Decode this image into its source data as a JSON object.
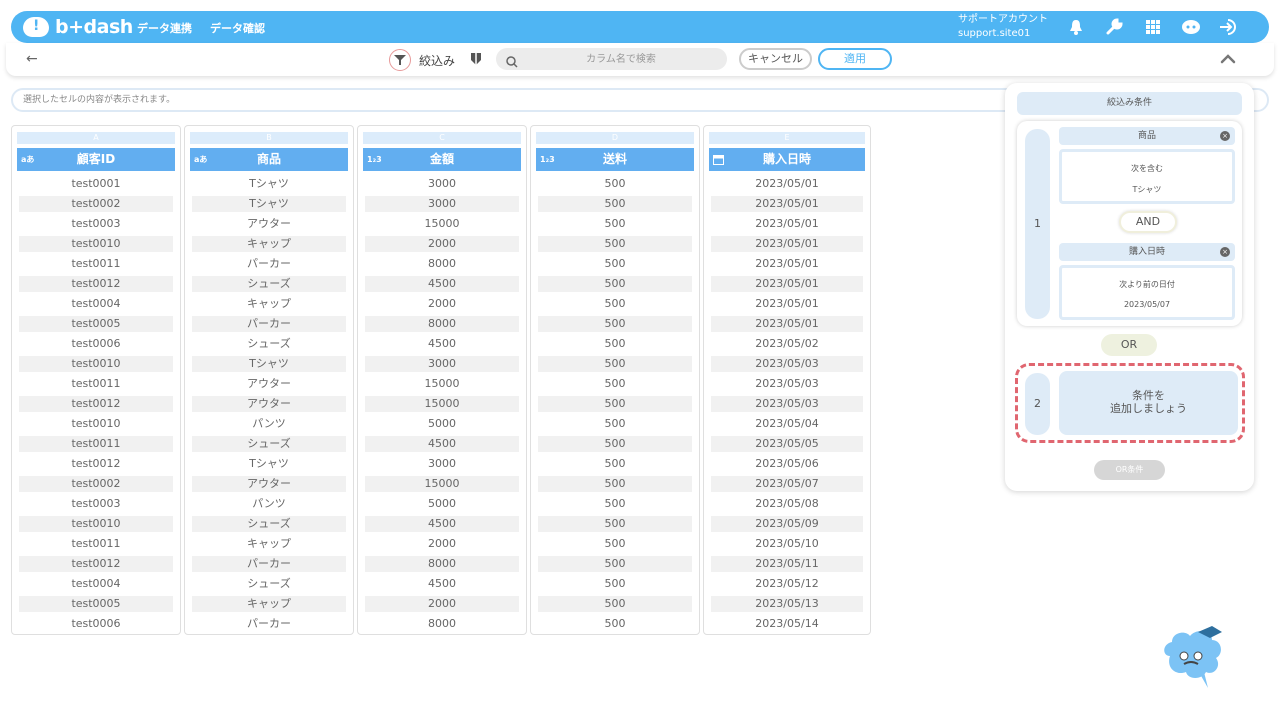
{
  "header": {
    "brand": "b+dash",
    "nav": [
      "データ連携",
      "データ確認"
    ],
    "account_name": "サポートアカウント",
    "account_id": "support.site01",
    "icons": [
      "bell-icon",
      "wrench-icon",
      "grid-icon",
      "mascot-badge-icon",
      "logout-icon"
    ]
  },
  "toolbar": {
    "back_label": "←",
    "filter_label": "絞込み",
    "search_placeholder": "カラム名で検索",
    "cancel_label": "キャンセル",
    "apply_label": "適用"
  },
  "cellbar": {
    "placeholder": "選択したセルの内容が表示されます。"
  },
  "columns": [
    {
      "letter": "A",
      "type_label": "aあ",
      "name": "顧客ID",
      "values": [
        "test0001",
        "test0002",
        "test0003",
        "test0010",
        "test0011",
        "test0012",
        "test0004",
        "test0005",
        "test0006",
        "test0010",
        "test0011",
        "test0012",
        "test0010",
        "test0011",
        "test0012",
        "test0002",
        "test0003",
        "test0010",
        "test0011",
        "test0012",
        "test0004",
        "test0005",
        "test0006"
      ]
    },
    {
      "letter": "B",
      "type_label": "aあ",
      "name": "商品",
      "values": [
        "Tシャツ",
        "Tシャツ",
        "アウター",
        "キャップ",
        "パーカー",
        "シューズ",
        "キャップ",
        "パーカー",
        "シューズ",
        "Tシャツ",
        "アウター",
        "アウター",
        "パンツ",
        "シューズ",
        "Tシャツ",
        "アウター",
        "パンツ",
        "シューズ",
        "キャップ",
        "パーカー",
        "シューズ",
        "キャップ",
        "パーカー"
      ]
    },
    {
      "letter": "C",
      "type_label": "1₂3",
      "name": "金額",
      "values": [
        "3000",
        "3000",
        "15000",
        "2000",
        "8000",
        "4500",
        "2000",
        "8000",
        "4500",
        "3000",
        "15000",
        "15000",
        "5000",
        "4500",
        "3000",
        "15000",
        "5000",
        "4500",
        "2000",
        "8000",
        "4500",
        "2000",
        "8000"
      ]
    },
    {
      "letter": "D",
      "type_label": "1₂3",
      "name": "送料",
      "values": [
        "500",
        "500",
        "500",
        "500",
        "500",
        "500",
        "500",
        "500",
        "500",
        "500",
        "500",
        "500",
        "500",
        "500",
        "500",
        "500",
        "500",
        "500",
        "500",
        "500",
        "500",
        "500",
        "500"
      ]
    },
    {
      "letter": "E",
      "type_label": "",
      "name": "購入日時",
      "values": [
        "2023/05/01",
        "2023/05/01",
        "2023/05/01",
        "2023/05/01",
        "2023/05/01",
        "2023/05/01",
        "2023/05/01",
        "2023/05/01",
        "2023/05/02",
        "2023/05/03",
        "2023/05/03",
        "2023/05/03",
        "2023/05/04",
        "2023/05/05",
        "2023/05/06",
        "2023/05/07",
        "2023/05/08",
        "2023/05/09",
        "2023/05/10",
        "2023/05/11",
        "2023/05/12",
        "2023/05/13",
        "2023/05/14"
      ]
    }
  ],
  "filter_panel": {
    "title": "絞込み条件",
    "group1": {
      "number": "1",
      "conditions": [
        {
          "column": "商品",
          "operator": "次を含む",
          "value": "Tシャツ"
        },
        {
          "column": "購入日時",
          "operator": "次より前の日付",
          "value": "2023/05/07"
        }
      ],
      "joiner": "AND"
    },
    "or_label": "OR",
    "group2": {
      "number": "2",
      "add_line1": "条件を",
      "add_line2": "追加しましょう"
    },
    "or_condition_button": "OR条件"
  },
  "colors": {
    "header_blue": "#4fb5f3",
    "column_head": "#62aef0",
    "highlight": "#e06670"
  }
}
